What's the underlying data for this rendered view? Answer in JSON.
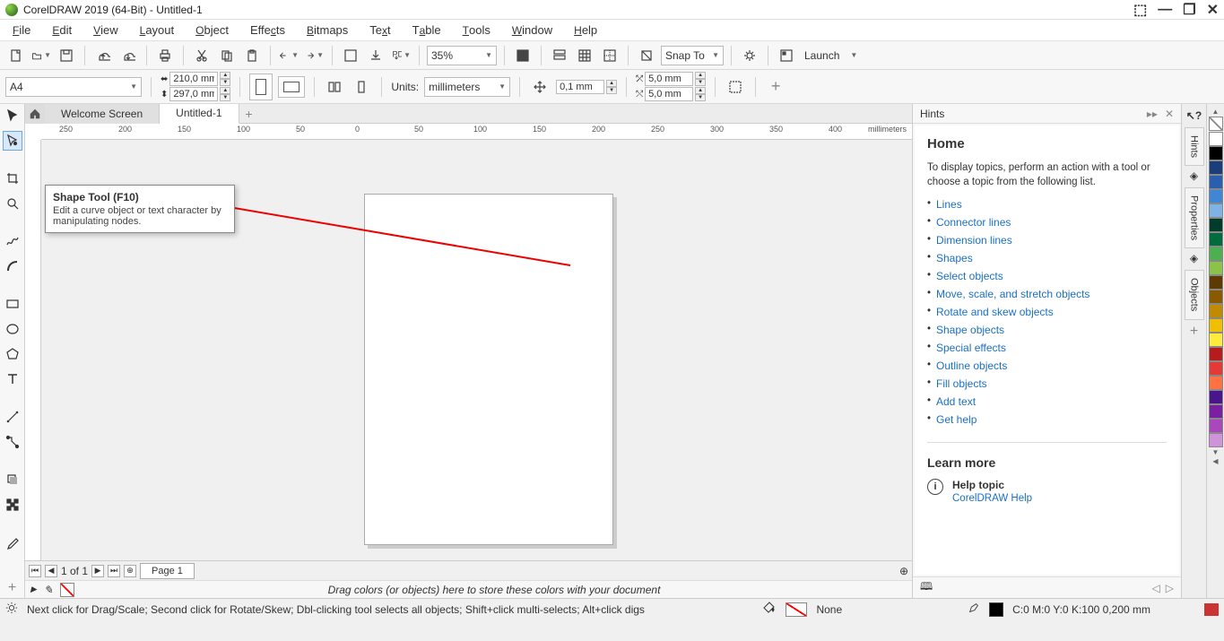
{
  "titlebar": {
    "title": "CorelDRAW 2019 (64-Bit) - Untitled-1"
  },
  "menu": {
    "file": "File",
    "edit": "Edit",
    "view": "View",
    "layout": "Layout",
    "object": "Object",
    "effects": "Effects",
    "bitmaps": "Bitmaps",
    "text": "Text",
    "table": "Table",
    "tools": "Tools",
    "window": "Window",
    "help": "Help"
  },
  "toolbar": {
    "zoom": "35%",
    "snap": "Snap To",
    "launch": "Launch"
  },
  "props": {
    "paper": "A4",
    "width": "210,0 mm",
    "height": "297,0 mm",
    "units_label": "Units:",
    "units": "millimeters",
    "nudge": "0,1 mm",
    "dupx": "5,0 mm",
    "dupy": "5,0 mm"
  },
  "tabs": {
    "welcome": "Welcome Screen",
    "doc": "Untitled-1"
  },
  "ruler_unit": "millimeters",
  "ruler_ticks": [
    "250",
    "200",
    "150",
    "100",
    "50",
    "0",
    "50",
    "100",
    "150",
    "200",
    "250",
    "300",
    "350",
    "400"
  ],
  "tooltip": {
    "title": "Shape Tool (F10)",
    "desc": "Edit a curve object or text character by manipulating nodes."
  },
  "hints": {
    "title": "Hints",
    "home": "Home",
    "intro": "To display topics, perform an action with a tool or choose a topic from the following list.",
    "links": [
      "Lines",
      "Connector lines",
      "Dimension lines",
      "Shapes",
      "Select objects",
      "Move, scale, and stretch objects",
      "Rotate and skew objects",
      "Shape objects",
      "Special effects",
      "Outline objects",
      "Fill objects",
      "Add text",
      "Get help"
    ],
    "learn": "Learn more",
    "helptopic": "Help topic",
    "helplink": "CorelDRAW Help"
  },
  "sidetabs": {
    "hints": "Hints",
    "properties": "Properties",
    "objects": "Objects"
  },
  "colors": [
    "#ffffff",
    "#000000",
    "#1a3e7a",
    "#2a5fb0",
    "#3e86d6",
    "#7fb3e6",
    "#003c2a",
    "#006b3c",
    "#4caf50",
    "#8bc34a",
    "#5c3a00",
    "#8a5a00",
    "#c28a00",
    "#f0c000",
    "#ffeb3b",
    "#b71c1c",
    "#e53935",
    "#ff7043",
    "#4a148c",
    "#7b1fa2",
    "#ab47bc",
    "#ce93d8"
  ],
  "pagebar": {
    "pageinfo": "1 of 1",
    "page": "Page 1"
  },
  "colorstrip": {
    "hint": "Drag colors (or objects) here to store these colors with your document"
  },
  "statusbar": {
    "hint": "Next click for Drag/Scale; Second click for Rotate/Skew; Dbl-clicking tool selects all objects; Shift+click multi-selects; Alt+click digs",
    "fill": "None",
    "outline": "C:0 M:0 Y:0 K:100 0,200 mm"
  }
}
